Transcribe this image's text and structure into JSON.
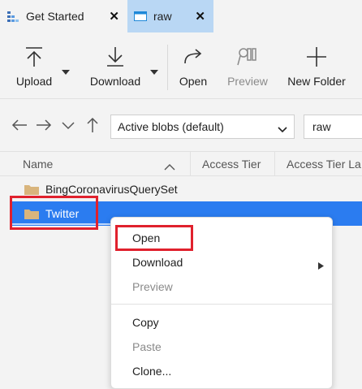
{
  "tabs": [
    {
      "label": "Get Started",
      "close": "✕"
    },
    {
      "label": "raw",
      "close": "✕"
    }
  ],
  "toolbar": {
    "upload_label": "Upload",
    "download_label": "Download",
    "open_label": "Open",
    "preview_label": "Preview",
    "new_folder_label": "New Folder"
  },
  "nav": {
    "blob_filter_value": "Active blobs (default)",
    "path_value": "raw"
  },
  "table": {
    "columns": [
      "Name",
      "Access Tier",
      "Access Tier La"
    ],
    "rows": [
      {
        "name": "BingCoronavirusQuerySet"
      },
      {
        "name": "Twitter"
      }
    ]
  },
  "context_menu": {
    "items": [
      "Open",
      "Download",
      "Preview",
      "Copy",
      "Paste",
      "Clone..."
    ]
  },
  "colors": {
    "selection": "#2b7cf0",
    "active_tab": "#b9d7f4",
    "highlight_box": "#e0212d",
    "folder": "#d9b57d"
  }
}
